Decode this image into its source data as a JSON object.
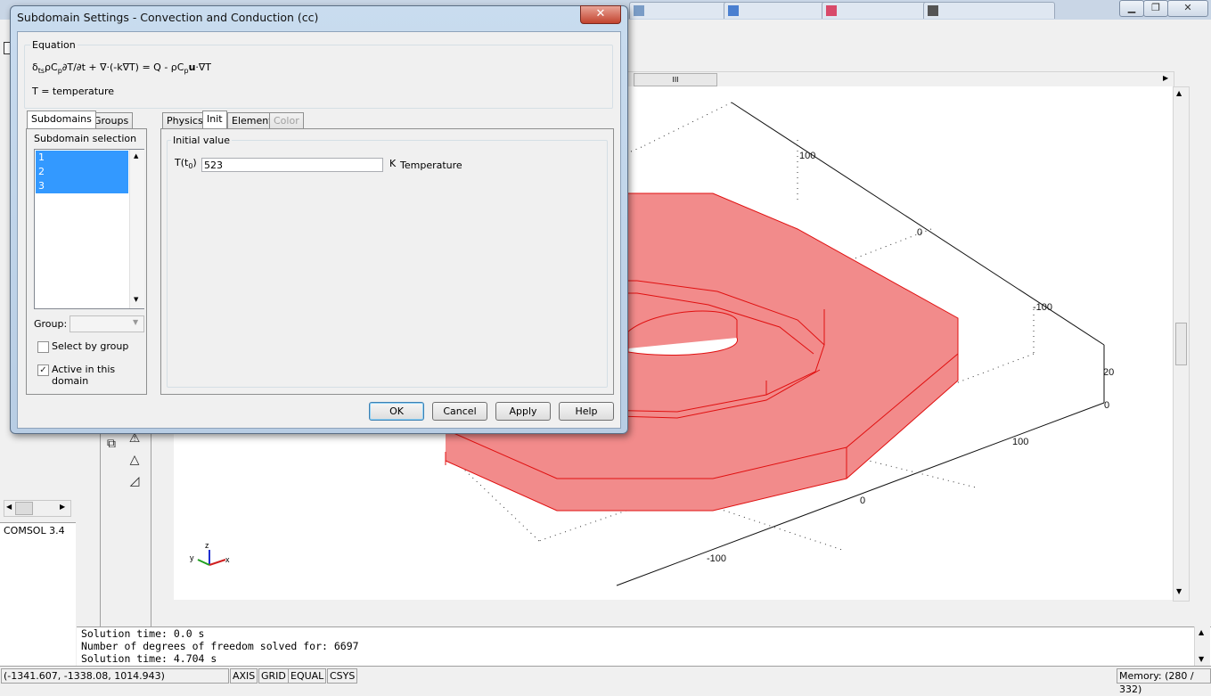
{
  "dialog": {
    "title": "Subdomain Settings - Convection and Conduction (cc)",
    "close_label": "✕",
    "equation": {
      "group_label": "Equation",
      "line1": "δtsρCp∂T/∂t + ∇·(-k∇T) = Q - ρCpu·∇T",
      "line2": "T = temperature"
    },
    "left_tabs": [
      "Subdomains",
      "Groups"
    ],
    "subdomain_selection": {
      "label": "Subdomain selection",
      "items": [
        "1",
        "2",
        "3"
      ]
    },
    "group_label": "Group:",
    "group_value": "",
    "select_by_group": {
      "label": "Select by group",
      "checked": false
    },
    "active_in_domain": {
      "label": "Active in this domain",
      "checked": true
    },
    "right_tabs": [
      "Physics",
      "Init",
      "Element",
      "Color"
    ],
    "initial_value": {
      "group_label": "Initial value",
      "var_label": "T(t",
      "var_sub": "0",
      "var_close": ")",
      "value": "523",
      "unit": "K",
      "description": "Temperature"
    },
    "buttons": {
      "ok": "OK",
      "cancel": "Cancel",
      "apply": "Apply",
      "help": "Help"
    }
  },
  "canvas": {
    "axis_labels": {
      "a1": "100",
      "a2": "0",
      "a3": "-100",
      "a4": "20",
      "a5": "0",
      "a6": "100",
      "a7": "0",
      "a8": "-100"
    },
    "triad": {
      "z": "z",
      "y": "y",
      "x": "x"
    },
    "hscroll_mark": "III"
  },
  "left_panel": {
    "version": "COMSOL 3.4"
  },
  "log": {
    "lines": [
      "Solution time: 0.0 s",
      "Number of degrees of freedom solved for: 6697",
      "Solution time: 4.704 s"
    ]
  },
  "statusbar": {
    "coords": "(-1341.607, -1338.08, 1014.943)",
    "axis": "AXIS",
    "grid": "GRID",
    "equal": "EQUAL",
    "csys": "CSYS",
    "memory": "Memory: (280 / 332)"
  },
  "colors": {
    "geometry_fill": "#f28b8b",
    "geometry_edge": "#e01010",
    "selection": "#3399ff"
  }
}
